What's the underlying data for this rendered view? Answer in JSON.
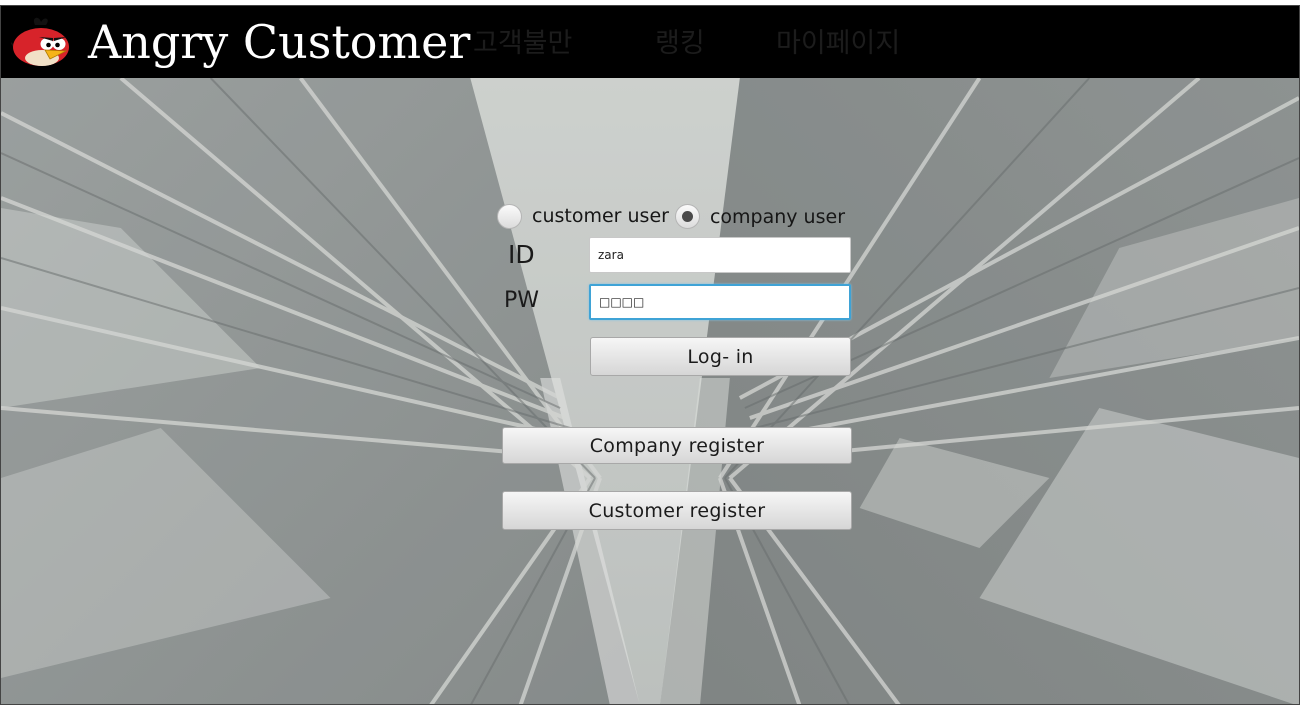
{
  "header": {
    "title": "Angry Customer",
    "logo_icon": "angry-bird-icon",
    "nav": [
      {
        "label": "고객불만"
      },
      {
        "label": "랭킹"
      },
      {
        "label": "마이페이지"
      }
    ]
  },
  "login": {
    "user_types": [
      {
        "label": "customer user",
        "selected": false
      },
      {
        "label": "company user",
        "selected": true
      }
    ],
    "id_label": "ID",
    "pw_label": "PW",
    "id_value": "zara",
    "pw_value": "□□□□",
    "login_button": "Log- in",
    "company_register_button": "Company register",
    "customer_register_button": "Customer register"
  },
  "colors": {
    "header_bg": "#000000",
    "title_text": "#ffffff",
    "focus_border": "#3fa3d6"
  }
}
